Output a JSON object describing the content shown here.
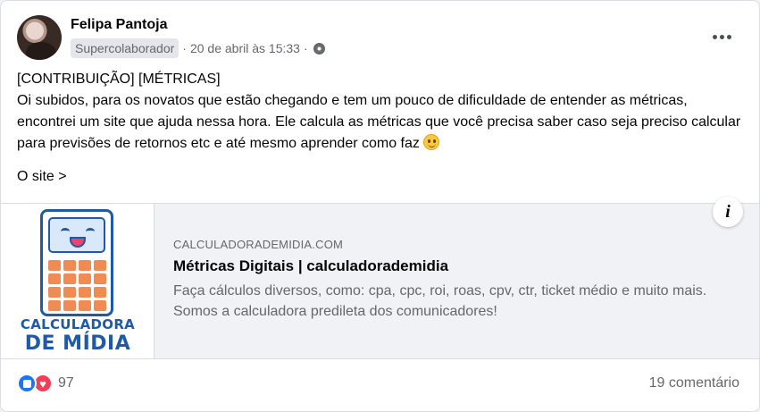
{
  "post": {
    "author": "Felipa Pantoja",
    "badge": "Supercolaborador",
    "separator1": "·",
    "timestamp": "20 de abril às 15:33",
    "separator2": "·",
    "privacy_icon": "globe-icon",
    "more_icon": "more-options-icon",
    "lines": [
      "[CONTRIBUIÇÃO] [MÉTRICAS]",
      "Oi subidos, para os novatos que estão chegando e tem um pouco de dificuldade de entender as métricas, encontrei um site que ajuda nessa hora. Ele calcula as métricas que você precisa saber caso seja preciso calcular para previsões de retornos etc e até mesmo aprender como faz"
    ],
    "emoji_icon": "slightly-smiling-face-icon",
    "site_link": "O site >"
  },
  "link_preview": {
    "thumbnail_line1": "CALCULADORA",
    "thumbnail_line2": "DE MÍDIA",
    "domain": "CALCULADORADEMIDIA.COM",
    "title": "Métricas Digitais | calculadorademidia",
    "description": "Faça cálculos diversos, como: cpa, cpc, roi, roas, cpv, ctr, ticket médio e muito mais. Somos a calculadora predileta dos comunicadores!",
    "info_label": "i"
  },
  "footer": {
    "reaction_icons": [
      "like-icon",
      "love-icon"
    ],
    "reaction_count": "97",
    "comments": "19 comentário"
  },
  "colors": {
    "facebook_blue": "#1877f2",
    "love_red": "#f33e58",
    "brand_blue": "#1f5aa8",
    "key_orange": "#f28a54",
    "secondary_text": "#65676b"
  }
}
